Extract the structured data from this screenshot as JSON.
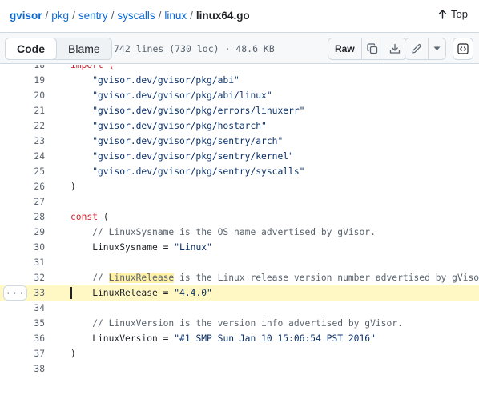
{
  "breadcrumb": {
    "items": [
      {
        "label": "gvisor"
      },
      {
        "label": "pkg"
      },
      {
        "label": "sentry"
      },
      {
        "label": "syscalls"
      },
      {
        "label": "linux"
      }
    ],
    "separator": "/",
    "file": "linux64.go"
  },
  "top_button": {
    "icon": "arrow-up-icon",
    "label": "Top"
  },
  "toolbar": {
    "code_tab": "Code",
    "blame_tab": "Blame",
    "file_meta": "742 lines (730 loc) · 48.6 KB",
    "raw_label": "Raw",
    "icons": [
      "copy-icon",
      "download-icon",
      "pencil-icon",
      "chevron-down-icon",
      "code-symbols-icon"
    ]
  },
  "code": {
    "lines": [
      {
        "num": "18",
        "tokens": [
          {
            "t": "import (",
            "c": "kw"
          }
        ]
      },
      {
        "num": "19",
        "tokens": [
          {
            "t": "    \"gvisor.dev/gvisor/pkg/abi\"",
            "c": "str"
          }
        ]
      },
      {
        "num": "20",
        "tokens": [
          {
            "t": "    \"gvisor.dev/gvisor/pkg/abi/linux\"",
            "c": "str"
          }
        ]
      },
      {
        "num": "21",
        "tokens": [
          {
            "t": "    \"gvisor.dev/gvisor/pkg/errors/linuxerr\"",
            "c": "str"
          }
        ]
      },
      {
        "num": "22",
        "tokens": [
          {
            "t": "    \"gvisor.dev/gvisor/pkg/hostarch\"",
            "c": "str"
          }
        ]
      },
      {
        "num": "23",
        "tokens": [
          {
            "t": "    \"gvisor.dev/gvisor/pkg/sentry/arch\"",
            "c": "str"
          }
        ]
      },
      {
        "num": "24",
        "tokens": [
          {
            "t": "    \"gvisor.dev/gvisor/pkg/sentry/kernel\"",
            "c": "str"
          }
        ]
      },
      {
        "num": "25",
        "tokens": [
          {
            "t": "    \"gvisor.dev/gvisor/pkg/sentry/syscalls\"",
            "c": "str"
          }
        ]
      },
      {
        "num": "26",
        "tokens": [
          {
            "t": ")",
            "c": ""
          }
        ]
      },
      {
        "num": "27",
        "tokens": []
      },
      {
        "num": "28",
        "tokens": [
          {
            "t": "const",
            "c": "kw"
          },
          {
            "t": " (",
            "c": ""
          }
        ]
      },
      {
        "num": "29",
        "tokens": [
          {
            "t": "    // LinuxSysname is the OS name advertised by gVisor.",
            "c": "cm"
          }
        ]
      },
      {
        "num": "30",
        "tokens": [
          {
            "t": "    LinuxSysname = ",
            "c": ""
          },
          {
            "t": "\"Linux\"",
            "c": "str"
          }
        ]
      },
      {
        "num": "31",
        "tokens": []
      },
      {
        "num": "32",
        "tokens": [
          {
            "t": "    // ",
            "c": "cm"
          },
          {
            "t": "LinuxRelease",
            "c": "cm mark"
          },
          {
            "t": " is the Linux release version number advertised by gVisor.",
            "c": "cm"
          }
        ]
      },
      {
        "num": "33",
        "tokens": [
          {
            "t": "    LinuxRelease = ",
            "c": ""
          },
          {
            "t": "\"4.4.0\"",
            "c": "str"
          }
        ],
        "highlight": true
      },
      {
        "num": "34",
        "tokens": []
      },
      {
        "num": "35",
        "tokens": [
          {
            "t": "    // LinuxVersion is the version info advertised by gVisor.",
            "c": "cm"
          }
        ]
      },
      {
        "num": "36",
        "tokens": [
          {
            "t": "    LinuxVersion = ",
            "c": ""
          },
          {
            "t": "\"#1 SMP Sun Jan 10 15:06:54 PST 2016\"",
            "c": "str"
          }
        ]
      },
      {
        "num": "37",
        "tokens": [
          {
            "t": ")",
            "c": ""
          }
        ]
      },
      {
        "num": "38",
        "tokens": []
      }
    ],
    "line_menu": "···"
  }
}
